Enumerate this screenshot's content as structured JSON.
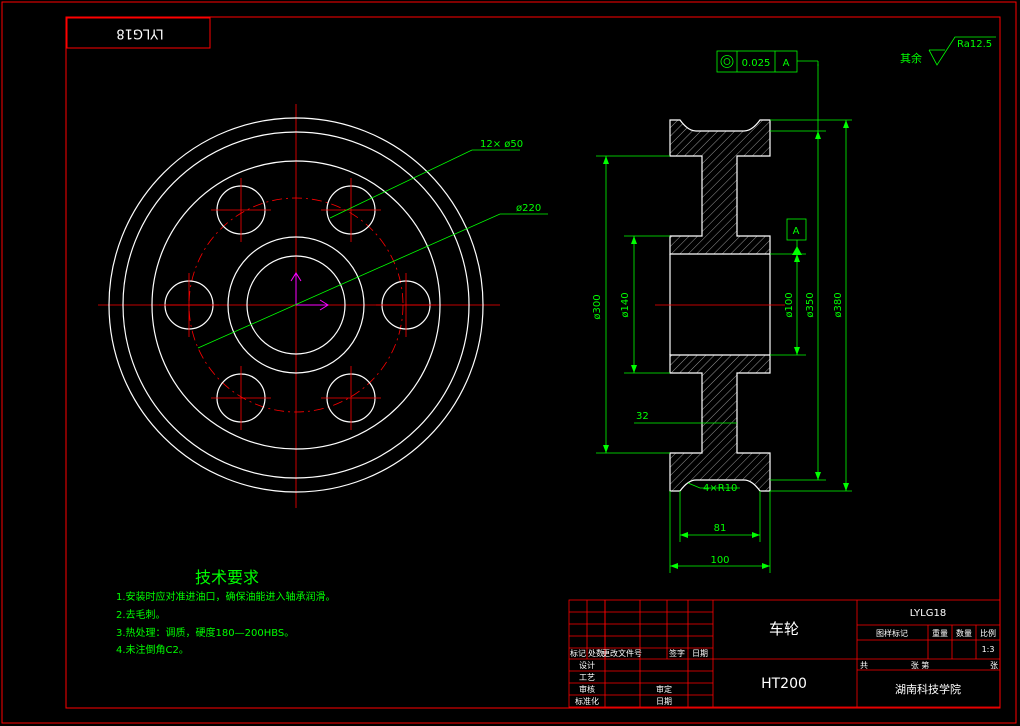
{
  "title_block": {
    "code_rotated": "LYLG18",
    "part_name": "车轮",
    "material": "HT200",
    "drawing_code": "LYLG18",
    "scale_label": "比例",
    "scale_value": "1:3",
    "mark_label": "图样标记",
    "weight_label": "重量",
    "qty_label": "数量",
    "header_row": [
      "标记",
      "处数",
      "更改文件号",
      "签字",
      "日期"
    ],
    "roles": [
      "设计",
      "工艺",
      "审核",
      "标准化"
    ],
    "approve_label": "审定",
    "date_label": "日期",
    "sheet_total_label": "共",
    "sheet_label": "张 第",
    "sheet_suffix": "张",
    "school": "湖南科技学院"
  },
  "tech": {
    "title": "技术要求",
    "lines": [
      "1.安装时应对准进油口，确保油能进入轴承润滑。",
      "2.去毛刺。",
      "3.热处理：调质，硬度180—200HBS。",
      "4.未注倒角C2。"
    ]
  },
  "dims": {
    "holes": "12× ø50",
    "pcd": "ø220",
    "d300": "ø300",
    "d140": "ø140",
    "d100": "ø100",
    "d350": "ø350",
    "d380": "ø380",
    "web": "32",
    "fillet": "4×R10",
    "w81": "81",
    "w100": "100"
  },
  "tolerance": {
    "value": "0.025",
    "datum": "A"
  },
  "datum_label": "A",
  "roughness": {
    "other_label": "其余",
    "value": "Ra12.5"
  },
  "colors": {
    "outline": "#ffffff",
    "dimension": "#00ff00",
    "center": "#ff0000",
    "frame": "#ff0000",
    "axis_marker": "#ff00ff"
  }
}
